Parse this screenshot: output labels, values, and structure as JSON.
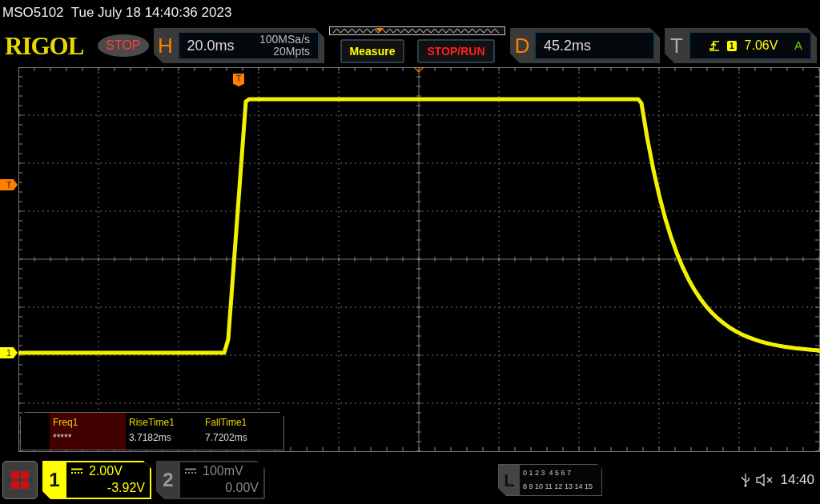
{
  "device": {
    "model": "MSO5102",
    "datetime": "Tue July 18 14:40:36 2023"
  },
  "header": {
    "logo": "RIGOL",
    "run_state": "STOP",
    "horizontal": {
      "label": "H",
      "timebase": "20.0ms",
      "sample_rate": "100MSa/s",
      "memory_depth": "20Mpts"
    },
    "buttons": [
      {
        "label": "Measure",
        "kind": "measure"
      },
      {
        "label": "STOP/RUN",
        "kind": "run"
      }
    ],
    "delay": {
      "label": "D",
      "value": "45.2ms"
    },
    "trigger": {
      "label": "T",
      "source": "1",
      "level": "7.06V",
      "mode": "A"
    }
  },
  "markers": {
    "trigger_position": "T",
    "trigger_level": "T",
    "channel": "1"
  },
  "measurements": [
    {
      "name": "Freq1",
      "value": "*****",
      "selected": true
    },
    {
      "name": "RiseTime1",
      "value": "3.7182ms",
      "selected": false
    },
    {
      "name": "FallTime1",
      "value": "7.7202ms",
      "selected": false
    }
  ],
  "channels": [
    {
      "number": "1",
      "scale": "2.00V",
      "offset": "-3.92V",
      "active": true
    },
    {
      "number": "2",
      "scale": "100mV",
      "offset": "0.00V",
      "active": false
    }
  ],
  "logic": {
    "label": "L",
    "rows": [
      "0 1 2 3  4 5 6 7",
      "8 9 10 11 12 13 14 15"
    ]
  },
  "status": {
    "time": "14:40"
  }
}
